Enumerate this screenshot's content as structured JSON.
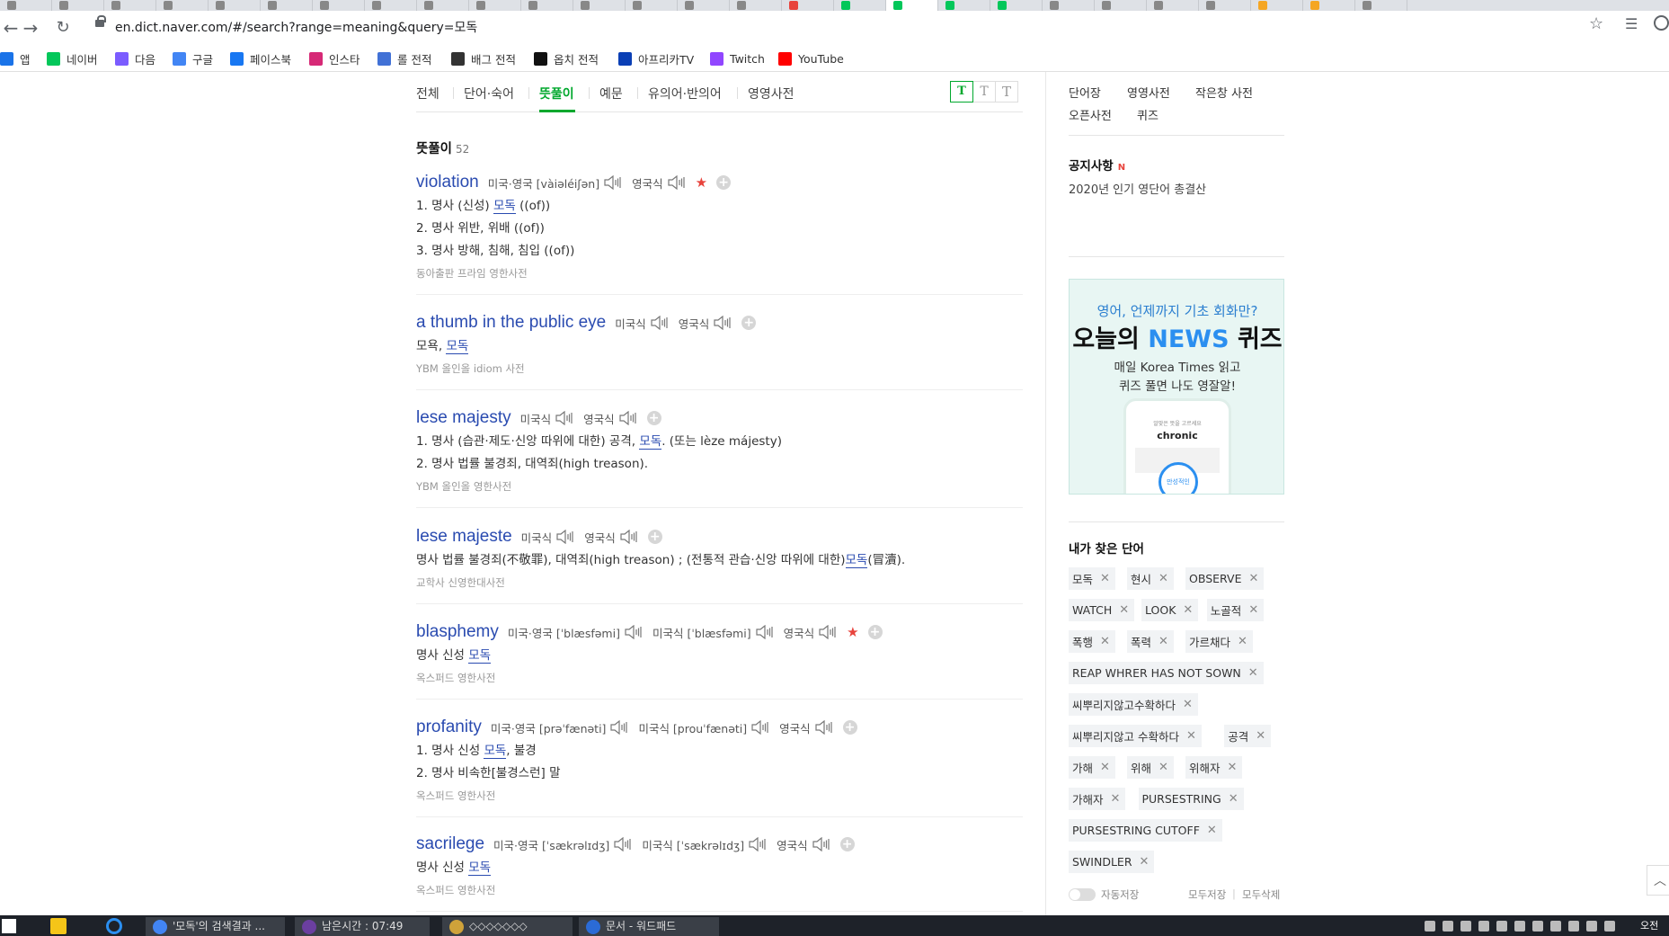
{
  "browser": {
    "url": "en.dict.naver.com/#/search?range=meaning&query=모독",
    "bookmarks": [
      {
        "label": "앱",
        "icon": "apps-grid-icon",
        "color": "#1a73e8"
      },
      {
        "label": "네이버",
        "icon": "naver-icon",
        "color": "#03c75a"
      },
      {
        "label": "다음",
        "icon": "daum-icon",
        "color": "#7b5cff"
      },
      {
        "label": "구글",
        "icon": "google-icon",
        "color": "#4285f4"
      },
      {
        "label": "페이스북",
        "icon": "facebook-icon",
        "color": "#1877f2"
      },
      {
        "label": "인스타",
        "icon": "instagram-icon",
        "color": "#d62976"
      },
      {
        "label": "롤 전적",
        "icon": "opgg-icon",
        "color": "#4171d6"
      },
      {
        "label": "배그 전적",
        "icon": "pubg-icon",
        "color": "#333333"
      },
      {
        "label": "옵치 전적",
        "icon": "overwatch-icon",
        "color": "#111111"
      },
      {
        "label": "아프리카TV",
        "icon": "afreecatv-icon",
        "color": "#0a3fb5"
      },
      {
        "label": "Twitch",
        "icon": "twitch-icon",
        "color": "#9146ff"
      },
      {
        "label": "YouTube",
        "icon": "youtube-icon",
        "color": "#ff0000"
      }
    ]
  },
  "tabs": [
    {
      "label": "전체"
    },
    {
      "label": "단어·숙어"
    },
    {
      "label": "뜻풀이",
      "active": true
    },
    {
      "label": "예문"
    },
    {
      "label": "유의어·반의어"
    },
    {
      "label": "영영사전"
    }
  ],
  "font_buttons": [
    "T",
    "T",
    "T"
  ],
  "section": {
    "title": "뜻풀이",
    "count": "52"
  },
  "entries": [
    {
      "word": "violation",
      "pron": [
        {
          "label": "미국·영국 [vàiəléiʃən]"
        },
        {
          "label": "영국식"
        }
      ],
      "starred": true,
      "meanings": [
        {
          "pre": "1. 명사 (신성) ",
          "hl": "모독",
          "post": " ((of))"
        },
        {
          "pre": "2. 명사 위반, 위배 ((of))",
          "hl": "",
          "post": ""
        },
        {
          "pre": "3. 명사 방해, 침해, 침입 ((of))",
          "hl": "",
          "post": ""
        }
      ],
      "source": "동아출판 프라임 영한사전"
    },
    {
      "word": "a thumb in the public eye",
      "pron": [
        {
          "label": "미국식"
        },
        {
          "label": "영국식"
        }
      ],
      "starred": false,
      "meanings": [
        {
          "pre": "모욕, ",
          "hl": "모독",
          "post": ""
        }
      ],
      "source": "YBM 올인올 idiom 사전"
    },
    {
      "word": "lese majesty",
      "pron": [
        {
          "label": "미국식"
        },
        {
          "label": "영국식"
        }
      ],
      "starred": false,
      "meanings": [
        {
          "pre": "1. 명사 (습관·제도·신앙 따위에 대한) 공격, ",
          "hl": "모독",
          "post": ". (또는 lèze májesty)"
        },
        {
          "pre": "2. 명사 법률 불경죄, 대역죄(high treason).",
          "hl": "",
          "post": ""
        }
      ],
      "source": "YBM 올인올 영한사전"
    },
    {
      "word": "lese majeste",
      "pron": [
        {
          "label": "미국식"
        },
        {
          "label": "영국식"
        }
      ],
      "starred": false,
      "meanings": [
        {
          "pre": "명사 법률 불경죄(不敬罪), 대역죄(high treason) ; (전통적 관습·신앙 따위에 대한)",
          "hl": "모독",
          "post": "(冒瀆)."
        }
      ],
      "source": "교학사 신영한대사전"
    },
    {
      "word": "blasphemy",
      "pron": [
        {
          "label": "미국·영국 [ˈblæsfəmi]"
        },
        {
          "label": "미국식 [ˈblæsfəmi]"
        },
        {
          "label": "영국식"
        }
      ],
      "starred": true,
      "meanings": [
        {
          "pre": "명사 신성 ",
          "hl": "모독",
          "post": ""
        }
      ],
      "source": "옥스퍼드 영한사전"
    },
    {
      "word": "profanity",
      "pron": [
        {
          "label": "미국·영국 [prəˈfænəti]"
        },
        {
          "label": "미국식 [prouˈfænəti]"
        },
        {
          "label": "영국식"
        }
      ],
      "starred": false,
      "meanings": [
        {
          "pre": "1. 명사 신성 ",
          "hl": "모독",
          "post": ", 불경"
        },
        {
          "pre": "2. 명사 비속한[불경스런] 말",
          "hl": "",
          "post": ""
        }
      ],
      "source": "옥스퍼드 영한사전"
    },
    {
      "word": "sacrilege",
      "pron": [
        {
          "label": "미국·영국 [ˈsækrəlɪdʒ]"
        },
        {
          "label": "미국식 [ˈsækrəlɪdʒ]"
        },
        {
          "label": "영국식"
        }
      ],
      "starred": false,
      "meanings": [
        {
          "pre": "명사 신성 ",
          "hl": "모독",
          "post": ""
        }
      ],
      "source": "옥스퍼드 영한사전"
    }
  ],
  "right": {
    "links": [
      "단어장",
      "영영사전",
      "작은창 사전",
      "오픈사전",
      "퀴즈"
    ],
    "notice": {
      "title": "공지사항",
      "badge": "N",
      "text": "2020년 인기 영단어 총결산"
    },
    "banner": {
      "line1": "영어, 언제까지 기초 회화만?",
      "line2_pre": "오늘의 ",
      "line2_news": "NEWS",
      "line2_post": " 퀴즈",
      "line3": "매일 Korea Times 읽고",
      "line4": "퀴즈 풀면 나도 영잘알!",
      "phone_small": "알맞은 뜻을 고르세요",
      "phone_word": "chronic",
      "phone_btn": "만성적인"
    },
    "my_words_title": "내가 찾은 단어",
    "my_words": [
      [
        "모독",
        "현시",
        "OBSERVE"
      ],
      [
        "WATCH",
        "LOOK",
        "노골적"
      ],
      [
        "폭행",
        "폭력",
        "가르채다"
      ],
      [
        "REAP WHRER HAS NOT SOWN"
      ],
      [
        "씨뿌리지않고수확하다"
      ],
      [
        "씨뿌리지않고 수확하다",
        "공격"
      ],
      [
        "가해",
        "위해",
        "위해자"
      ],
      [
        "가해자",
        "PURSESTRING"
      ],
      [
        "PURSESTRING CUTOFF"
      ],
      [
        "SWINDLER"
      ]
    ],
    "autosave": "자동저장",
    "save_all": "모두저장",
    "delete_all": "모두삭제"
  },
  "taskbar": {
    "tasks": [
      "'모독'의 검색결과 ...",
      "남은시간 : 07:49",
      "◇◇◇◇◇◇◇",
      "문서 - 워드패드"
    ],
    "clock": "오전"
  }
}
